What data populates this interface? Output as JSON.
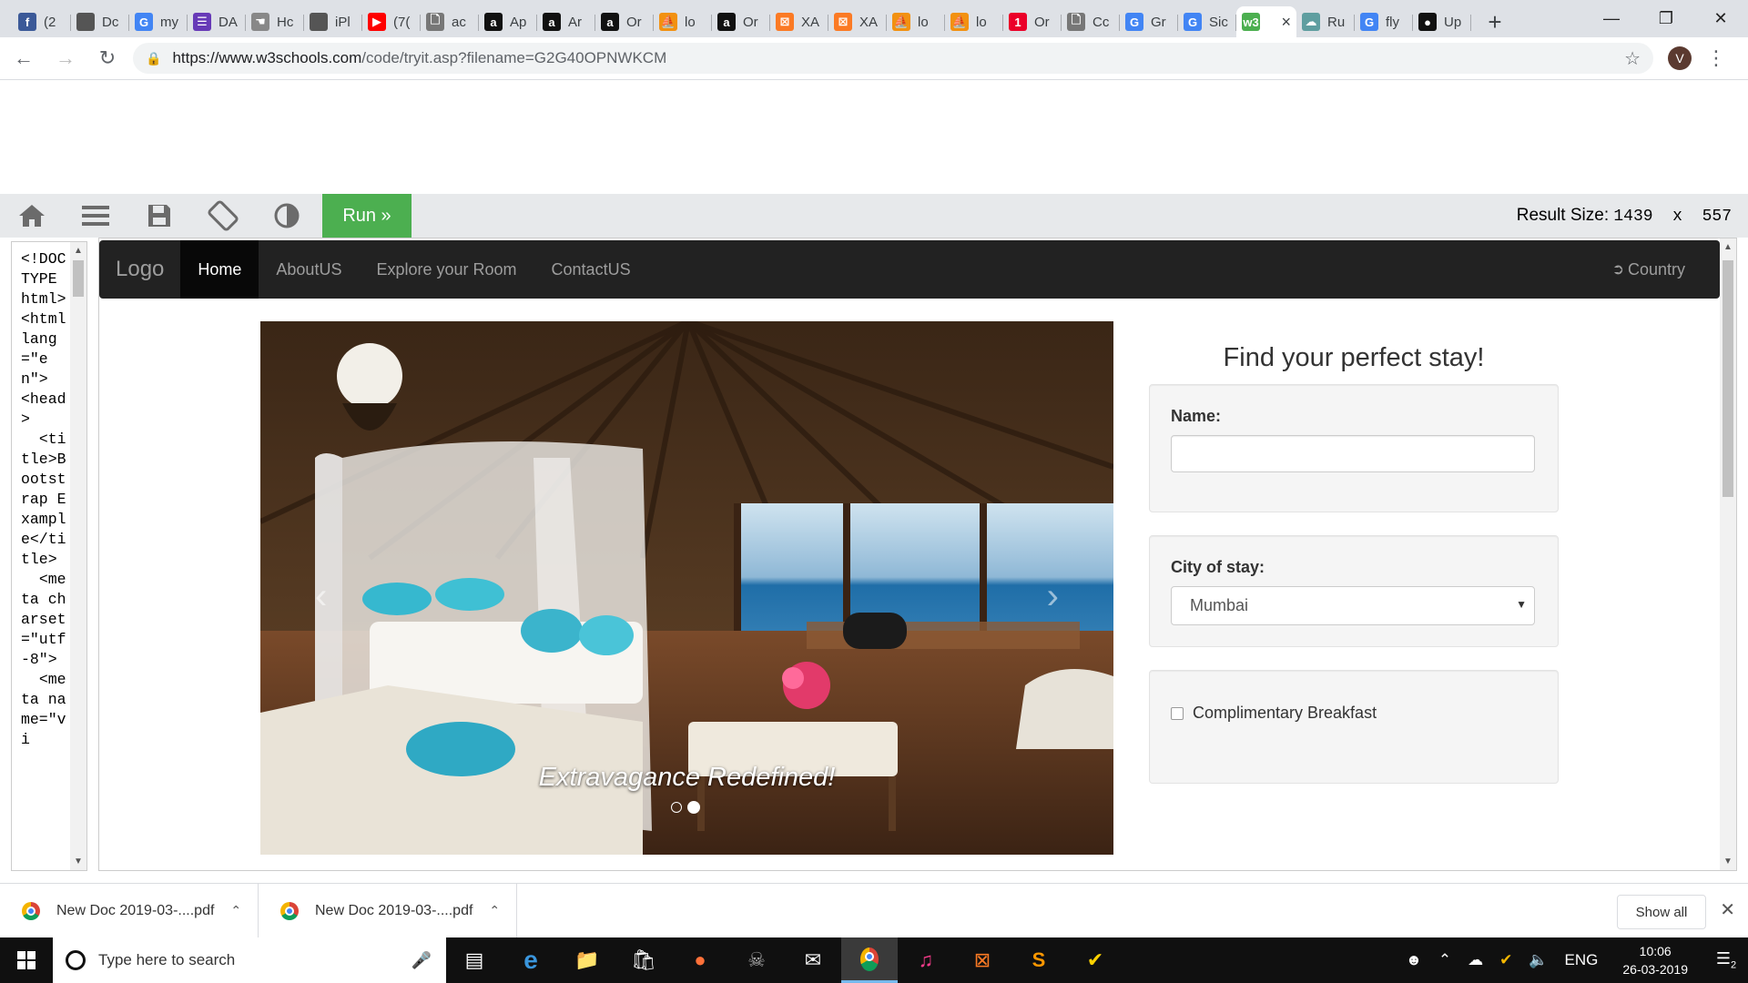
{
  "browser": {
    "tabs": [
      {
        "label": "(2",
        "icon": "facebook-icon",
        "color": "#3b5998",
        "glyph": "f"
      },
      {
        "label": "Dc",
        "icon": "apple-icon",
        "color": "#555555",
        "glyph": ""
      },
      {
        "label": "my",
        "icon": "google-icon",
        "color": "#4285f4",
        "glyph": "G"
      },
      {
        "label": "DA",
        "icon": "list-icon",
        "color": "#673ab7",
        "glyph": "☰"
      },
      {
        "label": "Hc",
        "icon": "hand-icon",
        "color": "#888888",
        "glyph": "☚"
      },
      {
        "label": "iPl",
        "icon": "apple-icon",
        "color": "#555555",
        "glyph": ""
      },
      {
        "label": "(7(",
        "icon": "youtube-icon",
        "color": "#ff0000",
        "glyph": "▶"
      },
      {
        "label": "ac",
        "icon": "document-icon",
        "color": "#777777",
        "glyph": "🗋"
      },
      {
        "label": "Ap",
        "icon": "amazon-icon",
        "color": "#111111",
        "glyph": "a"
      },
      {
        "label": "Ar",
        "icon": "amazon-icon",
        "color": "#111111",
        "glyph": "a"
      },
      {
        "label": "Or",
        "icon": "amazon-icon",
        "color": "#111111",
        "glyph": "a"
      },
      {
        "label": "lo",
        "icon": "phpmyadmin-icon",
        "color": "#f29111",
        "glyph": "⛵"
      },
      {
        "label": "Or",
        "icon": "amazon-icon",
        "color": "#111111",
        "glyph": "a"
      },
      {
        "label": "XA",
        "icon": "xampp-icon",
        "color": "#fb7a24",
        "glyph": "⊠"
      },
      {
        "label": "XA",
        "icon": "xampp-icon",
        "color": "#fb7a24",
        "glyph": "⊠"
      },
      {
        "label": "lo",
        "icon": "phpmyadmin-icon",
        "color": "#f29111",
        "glyph": "⛵"
      },
      {
        "label": "lo",
        "icon": "phpmyadmin-icon",
        "color": "#f29111",
        "glyph": "⛵"
      },
      {
        "label": "Or",
        "icon": "oneplus-icon",
        "color": "#eb0029",
        "glyph": "1"
      },
      {
        "label": "Cc",
        "icon": "document-icon",
        "color": "#777777",
        "glyph": "🗋"
      },
      {
        "label": "Gr",
        "icon": "google-icon",
        "color": "#4285f4",
        "glyph": "G"
      },
      {
        "label": "Sic",
        "icon": "google-icon",
        "color": "#4285f4",
        "glyph": "G"
      },
      {
        "label": "",
        "icon": "w3schools-icon",
        "color": "#4caf50",
        "glyph": "w3",
        "active": true
      },
      {
        "label": "Ru",
        "icon": "cloud-icon",
        "color": "#5f9ea0",
        "glyph": "☁"
      },
      {
        "label": "fly",
        "icon": "google-icon",
        "color": "#4285f4",
        "glyph": "G"
      },
      {
        "label": "Up",
        "icon": "github-icon",
        "color": "#111111",
        "glyph": "●"
      }
    ],
    "url_host": "https://www.w3schools.com",
    "url_rest": "/code/tryit.asp?filename=G2G40OPNWKCM",
    "profile_initial": "V"
  },
  "tryit": {
    "run_label": "Run »",
    "result_label": "Result Size:",
    "result_value": "1439  x  557",
    "code_lines": "<!DOCTYPE html>\n<html lang=\"en\">\n<head>\n  <title>Bootstrap Example</title>\n  <meta charset=\"utf-8\">\n  <meta name=\"vi"
  },
  "site": {
    "brand": "Logo",
    "nav": [
      "Home",
      "AboutUS",
      "Explore your Room",
      "ContactUS"
    ],
    "nav_right": "Country",
    "carousel_caption": "Extravagance Redefined!",
    "carousel_slide": 2,
    "carousel_total": 2,
    "form_title": "Find your perfect stay!",
    "name_label": "Name:",
    "name_value": "",
    "city_label": "City of stay:",
    "city_value": "Mumbai",
    "breakfast_label": "Complimentary Breakfast"
  },
  "downloads": {
    "items": [
      "New Doc 2019-03-....pdf",
      "New Doc 2019-03-....pdf"
    ],
    "show_all": "Show all"
  },
  "taskbar": {
    "search_placeholder": "Type here to search",
    "language": "ENG",
    "time": "10:06",
    "date": "26-03-2019",
    "notifications": "2"
  }
}
